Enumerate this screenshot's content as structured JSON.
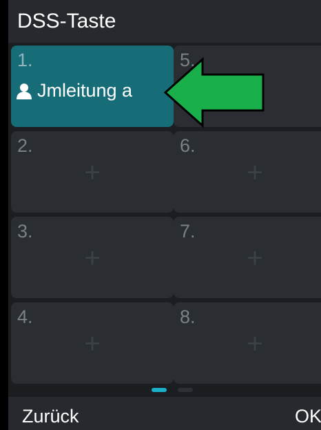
{
  "title": "DSS-Taste",
  "tiles": [
    {
      "number": "1.",
      "label": "Jmleitung a",
      "icon": "person-icon"
    },
    {
      "number": "2."
    },
    {
      "number": "3."
    },
    {
      "number": "4."
    },
    {
      "number": "5."
    },
    {
      "number": "6."
    },
    {
      "number": "7."
    },
    {
      "number": "8."
    }
  ],
  "softkeys": {
    "left": "Zurück",
    "right": "OK"
  },
  "colors": {
    "accent": "#176d77",
    "pager_active": "#19b0c8",
    "arrow": "#19b04c"
  }
}
